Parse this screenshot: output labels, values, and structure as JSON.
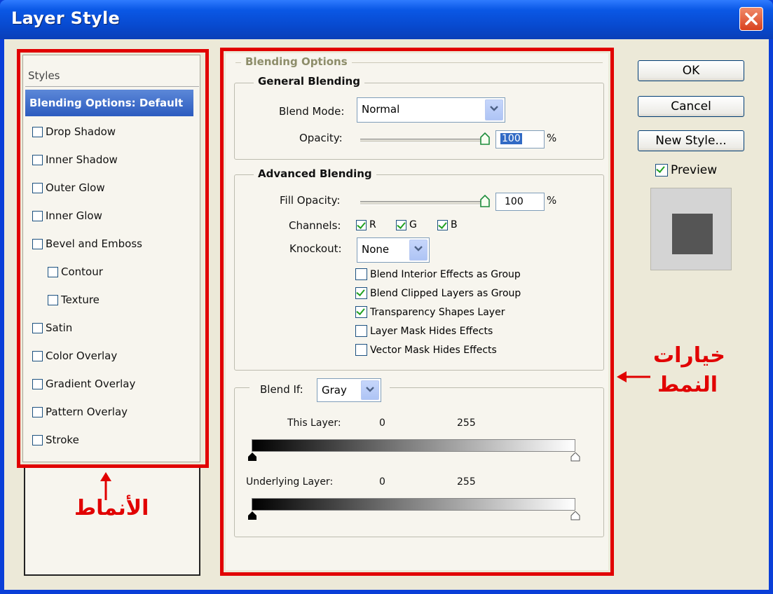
{
  "window": {
    "title": "Layer Style"
  },
  "styles_panel": {
    "header": "Styles",
    "items": [
      {
        "label": "Blending Options: Default",
        "selected": true,
        "has_checkbox": false
      },
      {
        "label": "Drop Shadow",
        "checked": false
      },
      {
        "label": "Inner Shadow",
        "checked": false
      },
      {
        "label": "Outer Glow",
        "checked": false
      },
      {
        "label": "Inner Glow",
        "checked": false
      },
      {
        "label": "Bevel and Emboss",
        "checked": false
      },
      {
        "label": "Contour",
        "checked": false,
        "indent": true
      },
      {
        "label": "Texture",
        "checked": false,
        "indent": true
      },
      {
        "label": "Satin",
        "checked": false
      },
      {
        "label": "Color Overlay",
        "checked": false
      },
      {
        "label": "Gradient Overlay",
        "checked": false
      },
      {
        "label": "Pattern Overlay",
        "checked": false
      },
      {
        "label": "Stroke",
        "checked": false
      }
    ]
  },
  "blending": {
    "title": "Blending Options",
    "general": {
      "title": "General Blending",
      "blend_mode_label": "Blend Mode:",
      "blend_mode_value": "Normal",
      "opacity_label": "Opacity:",
      "opacity_value": "100",
      "percent": "%"
    },
    "advanced": {
      "title": "Advanced Blending",
      "fill_opacity_label": "Fill Opacity:",
      "fill_opacity_value": "100",
      "percent": "%",
      "channels_label": "Channels:",
      "channels": [
        {
          "label": "R",
          "checked": true
        },
        {
          "label": "G",
          "checked": true
        },
        {
          "label": "B",
          "checked": true
        }
      ],
      "knockout_label": "Knockout:",
      "knockout_value": "None",
      "options": [
        {
          "label": "Blend Interior Effects as Group",
          "checked": false
        },
        {
          "label": "Blend Clipped Layers as Group",
          "checked": true
        },
        {
          "label": "Transparency Shapes Layer",
          "checked": true
        },
        {
          "label": "Layer Mask Hides Effects",
          "checked": false
        },
        {
          "label": "Vector Mask Hides Effects",
          "checked": false
        }
      ]
    },
    "blend_if": {
      "label": "Blend If:",
      "value": "Gray",
      "this_layer_label": "This Layer:",
      "this_layer_min": "0",
      "this_layer_max": "255",
      "underlying_label": "Underlying Layer:",
      "underlying_min": "0",
      "underlying_max": "255"
    }
  },
  "buttons": {
    "ok": "OK",
    "cancel": "Cancel",
    "new_style": "New Style...",
    "preview_label": "Preview",
    "preview_checked": true
  },
  "annotations": {
    "styles_caption": "الأنماط",
    "options_caption_line1": "خيارات",
    "options_caption_line2": "النمط",
    "highlight_color": "#e10000"
  },
  "colors": {
    "title_bar": "#0a58e6",
    "selection": "#2c5bbf",
    "dialog_bg": "#ece9d8"
  }
}
